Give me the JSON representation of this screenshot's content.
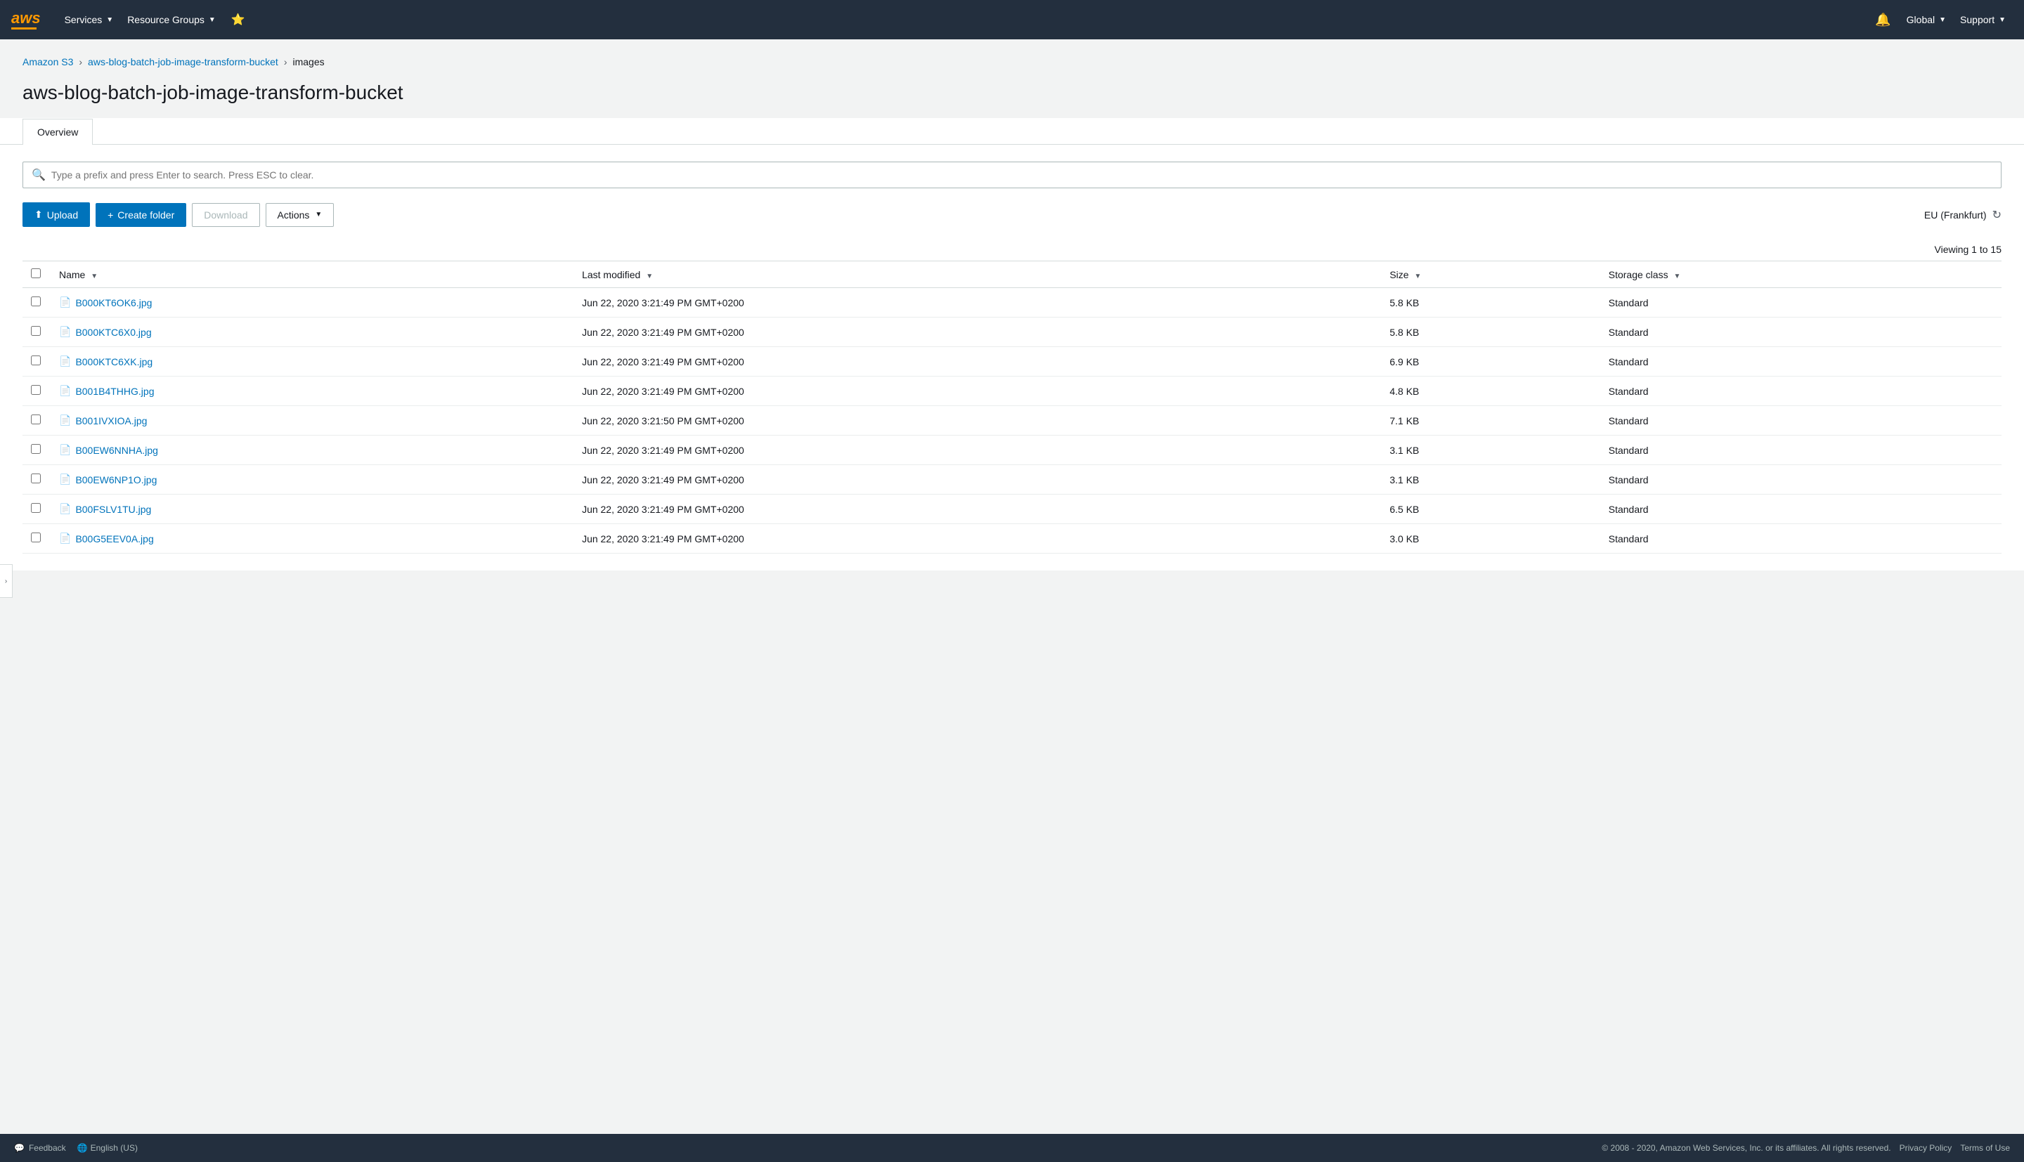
{
  "nav": {
    "logo": "aws",
    "services_label": "Services",
    "resource_groups_label": "Resource Groups",
    "global_label": "Global",
    "support_label": "Support"
  },
  "breadcrumb": {
    "s3_label": "Amazon S3",
    "bucket_label": "aws-blog-batch-job-image-transform-bucket",
    "current": "images"
  },
  "page": {
    "title": "aws-blog-batch-job-image-transform-bucket",
    "tab_overview": "Overview"
  },
  "search": {
    "placeholder": "Type a prefix and press Enter to search. Press ESC to clear."
  },
  "toolbar": {
    "upload_label": "Upload",
    "create_folder_label": "Create folder",
    "download_label": "Download",
    "actions_label": "Actions",
    "region_label": "EU (Frankfurt)",
    "viewing_label": "Viewing 1 to 15"
  },
  "table": {
    "columns": {
      "name": "Name",
      "last_modified": "Last modified",
      "size": "Size",
      "storage_class": "Storage class"
    },
    "rows": [
      {
        "name": "B000KT6OK6.jpg",
        "last_modified": "Jun 22, 2020 3:21:49 PM GMT+0200",
        "size": "5.8 KB",
        "storage_class": "Standard"
      },
      {
        "name": "B000KTC6X0.jpg",
        "last_modified": "Jun 22, 2020 3:21:49 PM GMT+0200",
        "size": "5.8 KB",
        "storage_class": "Standard"
      },
      {
        "name": "B000KTC6XK.jpg",
        "last_modified": "Jun 22, 2020 3:21:49 PM GMT+0200",
        "size": "6.9 KB",
        "storage_class": "Standard"
      },
      {
        "name": "B001B4THHG.jpg",
        "last_modified": "Jun 22, 2020 3:21:49 PM GMT+0200",
        "size": "4.8 KB",
        "storage_class": "Standard"
      },
      {
        "name": "B001IVXIOA.jpg",
        "last_modified": "Jun 22, 2020 3:21:50 PM GMT+0200",
        "size": "7.1 KB",
        "storage_class": "Standard"
      },
      {
        "name": "B00EW6NNHA.jpg",
        "last_modified": "Jun 22, 2020 3:21:49 PM GMT+0200",
        "size": "3.1 KB",
        "storage_class": "Standard"
      },
      {
        "name": "B00EW6NP1O.jpg",
        "last_modified": "Jun 22, 2020 3:21:49 PM GMT+0200",
        "size": "3.1 KB",
        "storage_class": "Standard"
      },
      {
        "name": "B00FSLV1TU.jpg",
        "last_modified": "Jun 22, 2020 3:21:49 PM GMT+0200",
        "size": "6.5 KB",
        "storage_class": "Standard"
      },
      {
        "name": "B00G5EEV0A.jpg",
        "last_modified": "Jun 22, 2020 3:21:49 PM GMT+0200",
        "size": "3.0 KB",
        "storage_class": "Standard"
      }
    ]
  },
  "footer": {
    "feedback_label": "Feedback",
    "language_label": "English (US)",
    "copyright": "© 2008 - 2020, Amazon Web Services, Inc. or its affiliates. All rights reserved.",
    "privacy_policy": "Privacy Policy",
    "terms_of_use": "Terms of Use"
  }
}
